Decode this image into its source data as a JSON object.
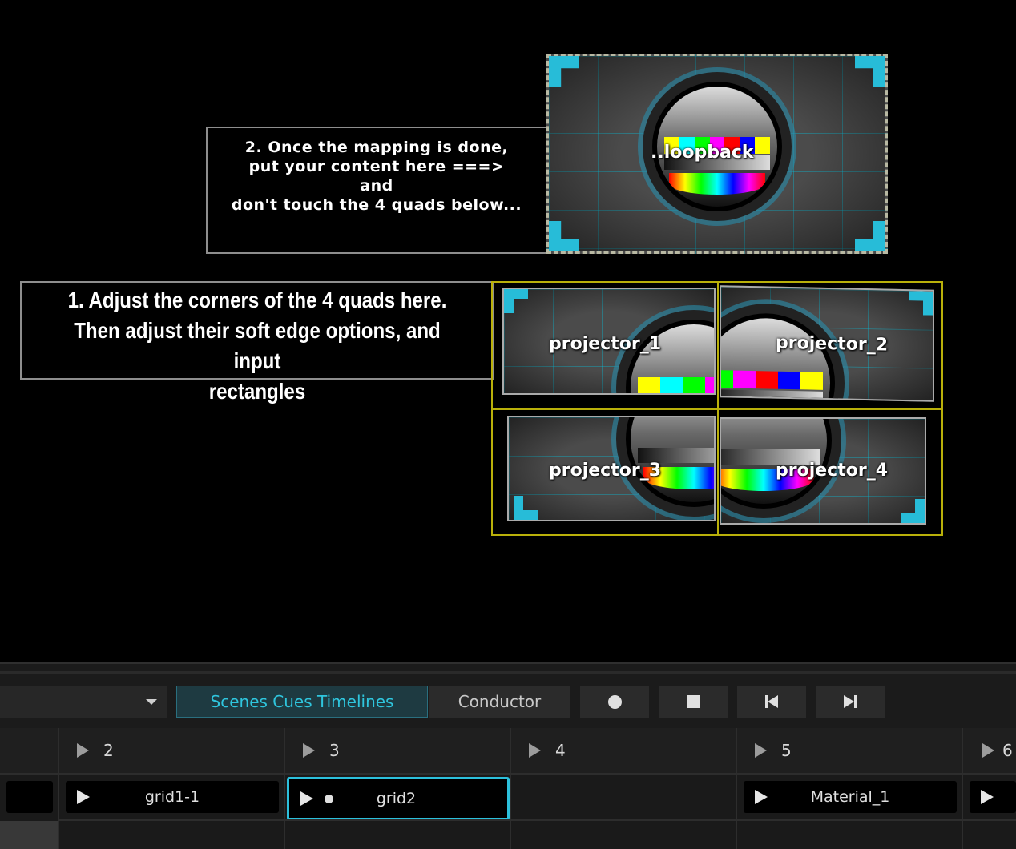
{
  "viewport": {
    "note_2": [
      "2. Once the mapping is done,",
      "put your content here ===>",
      "and",
      "don't touch the 4 quads below..."
    ],
    "note_1": [
      "1. Adjust the corners of the 4 quads here.",
      "Then adjust their soft edge options, and input",
      "rectangles"
    ],
    "loopback_label": "..loopback",
    "quads": [
      {
        "label": "projector_1"
      },
      {
        "label": "projector_2"
      },
      {
        "label": "projector_3"
      },
      {
        "label": "projector_4"
      }
    ]
  },
  "toolbar": {
    "tab_scenes": "Scenes Cues Timelines",
    "tab_conductor": "Conductor",
    "icons": [
      "record-icon",
      "stop-icon",
      "skip-first-icon",
      "skip-last-icon",
      "chevron-down-icon"
    ]
  },
  "grid": {
    "columns": [
      {
        "number": "",
        "cue": ""
      },
      {
        "number": "2",
        "cue": "grid1-1"
      },
      {
        "number": "3",
        "cue": "grid2",
        "active": true
      },
      {
        "number": "4",
        "cue": ""
      },
      {
        "number": "5",
        "cue": "Material_1"
      },
      {
        "number": "6",
        "cue": ""
      }
    ]
  },
  "colors": {
    "accent": "#2cc0dc",
    "active_tab_bg": "#1e3a41",
    "quad_outline": "#b9b00a",
    "corner_marker": "#27bcd8"
  }
}
